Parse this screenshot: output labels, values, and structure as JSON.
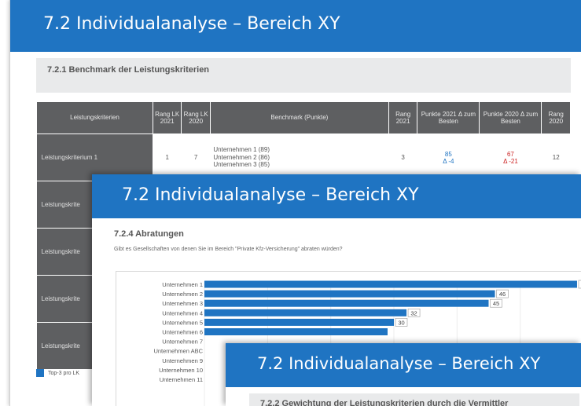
{
  "slide1": {
    "title": "7.2 Individualanalyse – Bereich XY",
    "subtitle": "7.2.1 Benchmark der Leistungskriterien",
    "table": {
      "headers": [
        "Leistungskriterien",
        "Rang LK 2021",
        "Rang LK 2020",
        "Benchmark (Punkte)",
        "Rang 2021",
        "Punkte 2021 Δ zum Besten",
        "Punkte 2020 Δ zum Besten",
        "Rang 2020"
      ],
      "rows": [
        {
          "name": "Leistungskriterium 1",
          "rang_lk_2021": "1",
          "rang_lk_2020": "7",
          "benchmark": [
            "Unternehmen 1 (89)",
            "Unternehmen 2 (86)",
            "Unternehmen 3 (85)"
          ],
          "rang_2021": "3",
          "punkte_2021": "85",
          "delta_2021": "Δ -4",
          "punkte_2020": "67",
          "delta_2020": "Δ -21",
          "rang_2020": "12"
        },
        {
          "name": "Leistungskrite"
        },
        {
          "name": "Leistungskrite"
        },
        {
          "name": "Leistungskrite"
        },
        {
          "name": "Leistungskrite"
        }
      ]
    },
    "legend_label": "Top-3 pro LK"
  },
  "slide2": {
    "title": "7.2 Individualanalyse – Bereich XY",
    "subtitle": "7.2.4 Abratungen",
    "question": "Gibt es Gesellschaften von denen Sie im Bereich \"Private Kfz-Versicherung\" abraten würden?"
  },
  "chart_data": {
    "type": "bar",
    "orientation": "horizontal",
    "categories": [
      "Unternehmen 1",
      "Unternehmen 2",
      "Unternehmen 3",
      "Unternehmen 4",
      "Unternehmen 5",
      "Unternehmen 6",
      "Unternehmen 7",
      "Unternehmen ABC",
      "Unternehmen 9",
      "Unternehmen 10",
      "Unternehmen 11"
    ],
    "values": [
      59,
      46,
      45,
      32,
      30,
      29,
      null,
      null,
      null,
      null,
      null
    ],
    "value_labels": [
      "59",
      "46",
      "45",
      "32",
      "30",
      "",
      "",
      "",
      "",
      "",
      ""
    ],
    "xlim": [
      0,
      60
    ],
    "grid": true,
    "bar_color": "#1f74c2"
  },
  "slide3": {
    "title": "7.2 Individualanalyse – Bereich XY",
    "subtitle": "7.2.2 Gewichtung der Leistungskriterien durch die Vermittler"
  }
}
